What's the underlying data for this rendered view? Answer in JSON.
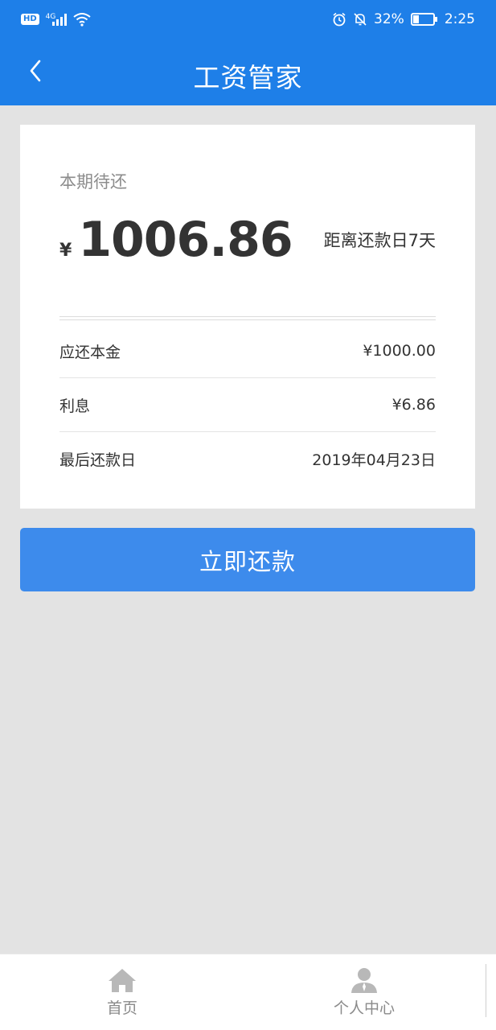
{
  "status_bar": {
    "hd": "HD",
    "network": "4G",
    "battery": "32%",
    "battery_level": 0.32,
    "time": "2:25"
  },
  "header": {
    "title": "工资管家"
  },
  "card": {
    "due_label": "本期待还",
    "currency": "¥",
    "amount": "1006.86",
    "days_left": "距离还款日7天",
    "details": [
      {
        "label": "应还本金",
        "value": "¥1000.00"
      },
      {
        "label": "利息",
        "value": "¥6.86"
      },
      {
        "label": "最后还款日",
        "value": "2019年04月23日"
      }
    ]
  },
  "repay_button": {
    "label": "立即还款"
  },
  "tabs": [
    {
      "label": "首页",
      "icon": "home-icon"
    },
    {
      "label": "个人中心",
      "icon": "user-icon"
    }
  ],
  "colors": {
    "primary": "#1e7fe8",
    "button": "#3d8bec",
    "background": "#e3e3e3"
  }
}
